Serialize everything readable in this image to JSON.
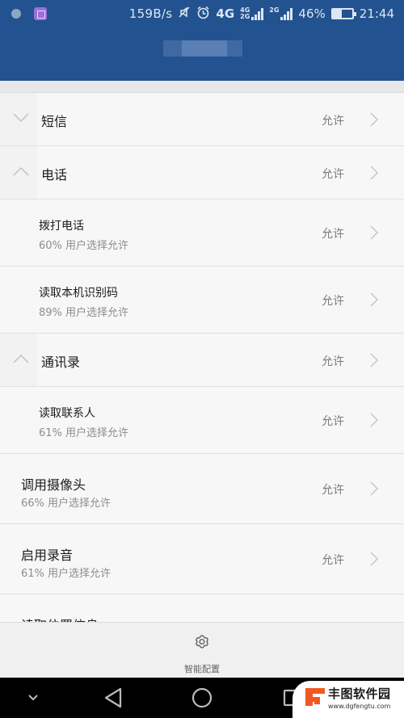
{
  "status_bar": {
    "net_speed": "159B/s",
    "network_4g": "4G",
    "sim1": "4G",
    "sim1b": "2G",
    "sim2": "2G",
    "battery_percent": "46%",
    "battery_level": 0.46,
    "time": "21:44"
  },
  "app_bar": {
    "title": "████"
  },
  "permissions": {
    "groups": [
      {
        "title": "短信",
        "status": "允许",
        "expanded": false
      },
      {
        "title": "电话",
        "status": "允许",
        "expanded": true,
        "children": [
          {
            "title": "拨打电话",
            "subtitle": "60% 用户选择允许",
            "status": "允许"
          },
          {
            "title": "读取本机识别码",
            "subtitle": "89% 用户选择允许",
            "status": "允许"
          }
        ]
      },
      {
        "title": "通讯录",
        "status": "允许",
        "expanded": true,
        "children": [
          {
            "title": "读取联系人",
            "subtitle": "61% 用户选择允许",
            "status": "允许"
          }
        ]
      }
    ],
    "items": [
      {
        "title": "调用摄像头",
        "subtitle": "66% 用户选择允许",
        "status": "允许"
      },
      {
        "title": "启用录音",
        "subtitle": "61% 用户选择允许",
        "status": "允许"
      },
      {
        "title": "读取位置信息",
        "subtitle": "",
        "status": ""
      }
    ]
  },
  "bottom_bar": {
    "smart_config_label": "智能配置"
  },
  "watermark": {
    "name": "丰图软件园",
    "url": "www.dgfengtu.com",
    "brand_color": "#f05a22"
  },
  "colors": {
    "primary": "#22528f",
    "background": "#f7f7f7"
  }
}
